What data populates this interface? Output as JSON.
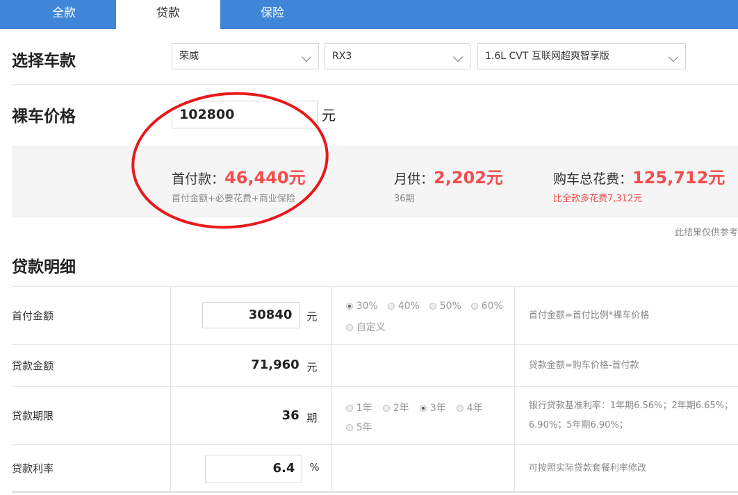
{
  "tabs": [
    {
      "label": "全款",
      "active": false
    },
    {
      "label": "贷款",
      "active": true
    },
    {
      "label": "保险",
      "active": false
    }
  ],
  "select_car": {
    "title": "选择车款",
    "brand": "荣威",
    "model": "RX3",
    "version": "1.6L CVT 互联网超爽智享版"
  },
  "bare_price": {
    "title": "裸车价格",
    "value": "102800",
    "unit": "元"
  },
  "summary": {
    "down_payment_label": "首付款：",
    "down_payment_value": "46,440元",
    "down_payment_sub": "首付金额+必要花费+商业保险",
    "monthly_label": "月供：",
    "monthly_value": "2,202元",
    "monthly_sub": "36期",
    "total_label": "购车总花费：",
    "total_value": "125,712元",
    "total_sub": "比全款多花费7,312元"
  },
  "note": "此结果仅供参考",
  "detail": {
    "title": "贷款明细",
    "rows": [
      {
        "label": "首付金额",
        "value": "30840",
        "unit": "元",
        "options": [
          "30%",
          "40%",
          "50%",
          "60%",
          "自定义"
        ],
        "selected": "30%",
        "hint": "首付金额=首付比例*裸车价格"
      },
      {
        "label": "贷款金额",
        "value": "71,960",
        "unit": "元",
        "hint": "贷款金额=购车价格-首付款"
      },
      {
        "label": "贷款期限",
        "value": "36",
        "unit": "期",
        "options": [
          "1年",
          "2年",
          "3年",
          "4年",
          "5年"
        ],
        "selected": "3年",
        "hint": "银行贷款基准利率：1年期6.56%；2年期6.65%；",
        "hint2": "6.90%；5年期6.90%；"
      },
      {
        "label": "贷款利率",
        "value": "6.4",
        "unit": "%",
        "hint": "可按照实际贷款套餐利率修改"
      }
    ]
  },
  "colors": {
    "tab_bar": "#3f86d9",
    "highlight_red": "#f24d4d",
    "annotation_circle": "#e8191c"
  }
}
